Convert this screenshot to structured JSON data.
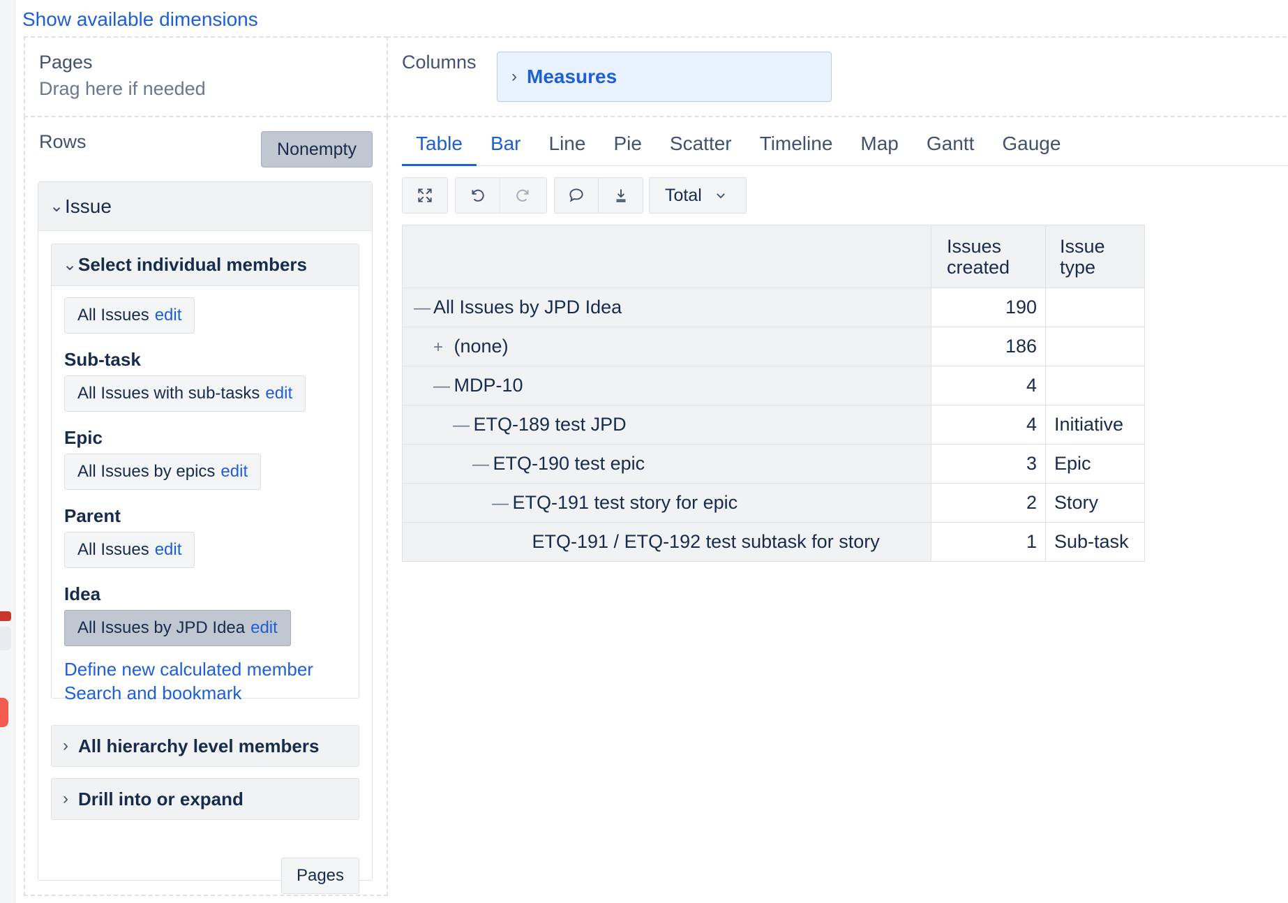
{
  "header": {
    "show_dimensions_link": "Show available dimensions"
  },
  "pages": {
    "title": "Pages",
    "hint": "Drag here if needed"
  },
  "columns": {
    "title": "Columns",
    "chip_label": "Measures"
  },
  "rows": {
    "title": "Rows",
    "nonempty_label": "Nonempty",
    "dimension": "Issue",
    "select_section": "Select individual members",
    "members": [
      {
        "level": "",
        "label": "All Issues",
        "edit": "edit"
      },
      {
        "level": "Sub-task",
        "label": "All Issues with sub-tasks",
        "edit": "edit"
      },
      {
        "level": "Epic",
        "label": "All Issues by epics",
        "edit": "edit"
      },
      {
        "level": "Parent",
        "label": "All Issues",
        "edit": "edit"
      },
      {
        "level": "Idea",
        "label": "All Issues by JPD Idea",
        "edit": "edit"
      }
    ],
    "define_link": "Define new calculated member",
    "search_link": "Search and bookmark",
    "hierarchy_section": "All hierarchy level members",
    "drill_section": "Drill into or expand",
    "pages_button": "Pages"
  },
  "tabs": [
    {
      "label": "Table",
      "active": true
    },
    {
      "label": "Bar"
    },
    {
      "label": "Line"
    },
    {
      "label": "Pie"
    },
    {
      "label": "Scatter"
    },
    {
      "label": "Timeline"
    },
    {
      "label": "Map"
    },
    {
      "label": "Gantt"
    },
    {
      "label": "Gauge"
    }
  ],
  "toolbar": {
    "icons": [
      "fullscreen-icon",
      "undo-icon",
      "redo-icon",
      "comment-icon",
      "download-icon"
    ],
    "total_label": "Total"
  },
  "table": {
    "headers": [
      "Issues created",
      "Issue type"
    ],
    "header_lines": [
      [
        "Issues",
        "created"
      ],
      [
        "Issue",
        "type"
      ]
    ],
    "rows": [
      {
        "toggle": "—",
        "label": "All Issues by JPD Idea",
        "issues_created": "190",
        "issue_type": ""
      },
      {
        "toggle": "+",
        "label": "(none)",
        "issues_created": "186",
        "issue_type": ""
      },
      {
        "toggle": "—",
        "label": "MDP-10",
        "issues_created": "4",
        "issue_type": ""
      },
      {
        "toggle": "—",
        "label": "ETQ-189 test JPD",
        "issues_created": "4",
        "issue_type": "Initiative"
      },
      {
        "toggle": "—",
        "label": "ETQ-190 test epic",
        "issues_created": "3",
        "issue_type": "Epic"
      },
      {
        "toggle": "—",
        "label": "ETQ-191 test story for epic",
        "issues_created": "2",
        "issue_type": "Story"
      },
      {
        "toggle": "",
        "label": "ETQ-191 / ETQ-192 test subtask for story",
        "issues_created": "1",
        "issue_type": "Sub-task"
      }
    ]
  },
  "colors": {
    "link": "#1d5fd6",
    "header_bg": "#f1f2f4",
    "active_chip": "#c1c7d0",
    "measures_bg": "#e9f2ff"
  }
}
